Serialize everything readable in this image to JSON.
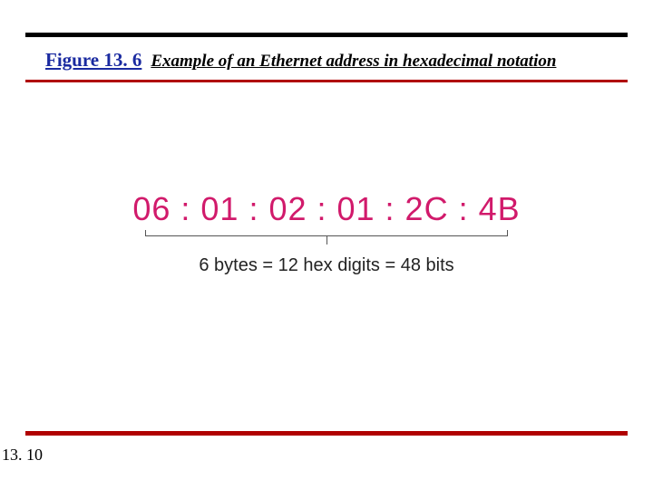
{
  "caption": {
    "label": "Figure 13. 6",
    "title": "Example of an Ethernet address in hexadecimal notation"
  },
  "mac_address": "06 : 01 : 02 : 01 : 2C : 4B",
  "mac_note": "6 bytes = 12 hex digits = 48 bits",
  "page_number": "13. 10",
  "colors": {
    "accent_blue": "#1a2aa0",
    "accent_red": "#b00000",
    "mac_pink": "#d11a6b"
  }
}
